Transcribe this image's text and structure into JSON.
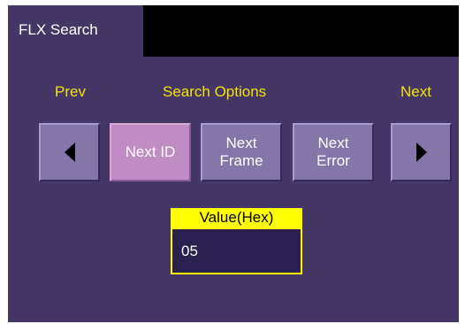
{
  "tab": {
    "title": "FLX Search"
  },
  "labels": {
    "prev": "Prev",
    "search_options": "Search Options",
    "next": "Next"
  },
  "buttons": {
    "next_id": "Next ID",
    "next_frame_line1": "Next",
    "next_frame_line2": "Frame",
    "next_error_line1": "Next",
    "next_error_line2": "Error"
  },
  "value": {
    "header": "Value(Hex)",
    "current": "05"
  },
  "colors": {
    "panel_background": "#443766",
    "label_text": "#f2e20c",
    "button": "#8476a8",
    "active_button": "#c08cc4",
    "value_header": "#ffff00",
    "value_field": "#2a2150"
  },
  "icons": {
    "prev": "triangle-left-icon",
    "next": "triangle-right-icon"
  }
}
